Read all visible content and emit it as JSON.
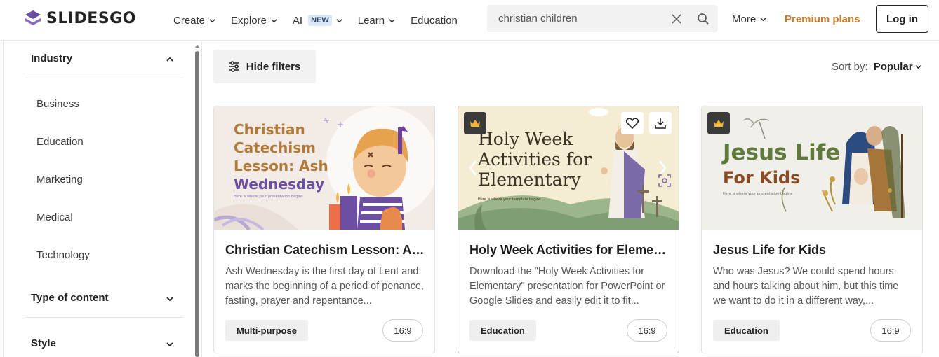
{
  "header": {
    "logo_text": "SLIDESGO",
    "nav": [
      {
        "label": "Create",
        "has_dropdown": true
      },
      {
        "label": "Explore",
        "has_dropdown": true
      },
      {
        "label": "AI",
        "badge": "NEW",
        "has_dropdown": true
      },
      {
        "label": "Learn",
        "has_dropdown": true
      },
      {
        "label": "Education",
        "has_dropdown": false
      }
    ],
    "search_value": "christian children",
    "more_label": "More",
    "premium_label": "Premium plans",
    "login_label": "Log in"
  },
  "sidebar": {
    "sections": [
      {
        "title": "Industry",
        "expanded": true,
        "items": [
          "Business",
          "Education",
          "Marketing",
          "Medical",
          "Technology"
        ]
      },
      {
        "title": "Type of content",
        "expanded": false
      },
      {
        "title": "Style",
        "expanded": false
      }
    ]
  },
  "toolbar": {
    "hide_filters_label": "Hide filters",
    "sort_label": "Sort by:",
    "sort_value": "Popular"
  },
  "cards": [
    {
      "title": "Christian Catechism Lesson: Ash Wednesday",
      "description": "Ash Wednesday is the first day of Lent and marks the beginning of a period of penance, fasting, prayer and repentance...",
      "tag": "Multi-purpose",
      "ratio": "16:9",
      "premium": false,
      "thumb_title_lines": [
        "Christian",
        "Catechism",
        "Lesson: Ash",
        "Wednesday"
      ],
      "thumb_subtitle": "Here is where your presentation begins"
    },
    {
      "title": "Holy Week Activities for Elementary",
      "description": "Download the \"Holy Week Activities for Elementary\" presentation for PowerPoint or Google Slides and easily edit it to fit...",
      "tag": "Education",
      "ratio": "16:9",
      "premium": true,
      "thumb_title_lines": [
        "Holy Week",
        "Activities for",
        "Elementary"
      ],
      "thumb_subtitle": "Here is where your template begins"
    },
    {
      "title": "Jesus Life for Kids",
      "description": "Who was Jesus? We could spend hours and hours talking about him, but this time we want to do it in a different way,...",
      "tag": "Education",
      "ratio": "16:9",
      "premium": true,
      "thumb_title_lines": [
        "Jesus Life",
        "For Kids"
      ],
      "thumb_subtitle": "Here is where your presentation begins"
    }
  ],
  "colors": {
    "brand_purple": "#6b4fa0",
    "premium_orange": "#c87a2a",
    "text_dark": "#1e1e1e"
  }
}
